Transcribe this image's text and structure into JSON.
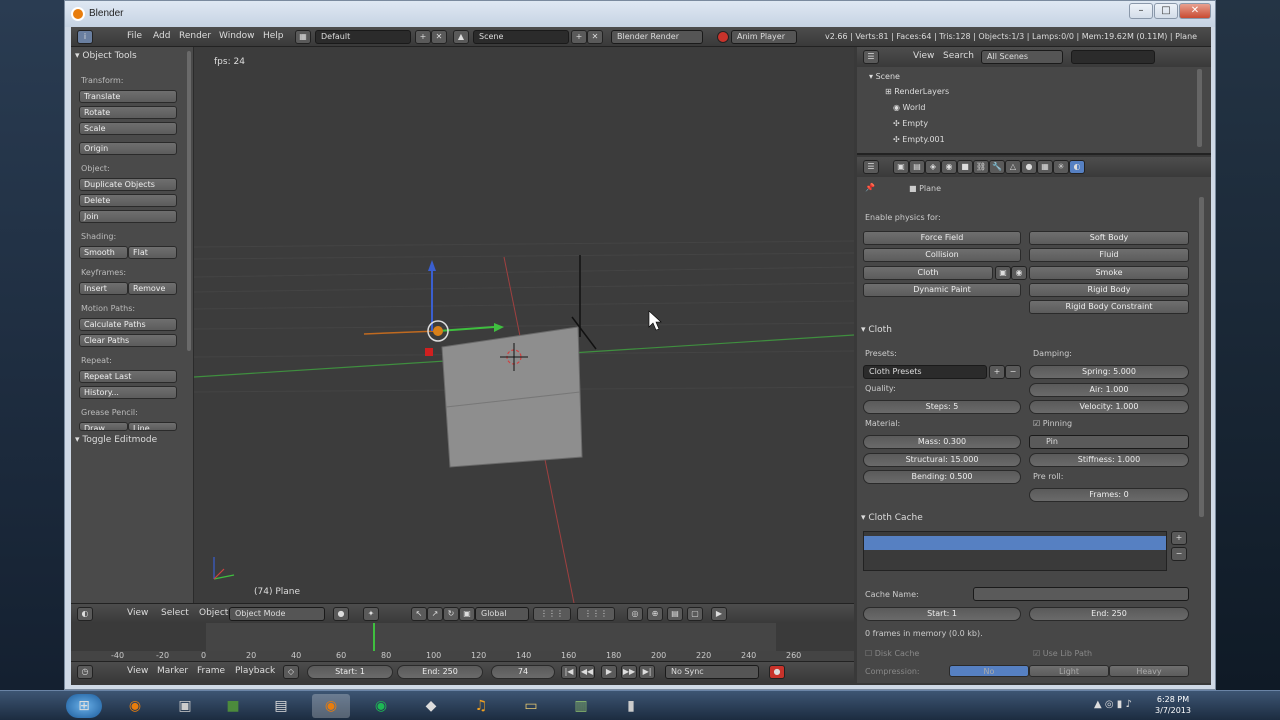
{
  "window": {
    "title": "Blender"
  },
  "topbar": {
    "menus": [
      "File",
      "Add",
      "Render",
      "Window",
      "Help"
    ],
    "layout": "Default",
    "scene": "Scene",
    "engine": "Blender Render",
    "anim_player": "Anim Player",
    "stats": "v2.66 | Verts:81 | Faces:64 | Tris:128 | Objects:1/3 | Lamps:0/0 | Mem:19.62M (0.11M) | Plane"
  },
  "tools": {
    "header": "Object Tools",
    "transform_label": "Transform:",
    "translate": "Translate",
    "rotate": "Rotate",
    "scale": "Scale",
    "origin": "Origin",
    "object_label": "Object:",
    "duplicate": "Duplicate Objects",
    "delete": "Delete",
    "join": "Join",
    "shading_label": "Shading:",
    "smooth": "Smooth",
    "flat": "Flat",
    "keyframes_label": "Keyframes:",
    "insert": "Insert",
    "remove": "Remove",
    "motion_label": "Motion Paths:",
    "calc_paths": "Calculate Paths",
    "clear_paths": "Clear Paths",
    "repeat_label": "Repeat:",
    "repeat_last": "Repeat Last",
    "history": "History...",
    "grease_label": "Grease Pencil:",
    "draw": "Draw",
    "line": "Line",
    "toggle_edit": "Toggle Editmode"
  },
  "viewport": {
    "fps": "fps: 24",
    "object_name": "(74) Plane"
  },
  "vpheader": {
    "view": "View",
    "select": "Select",
    "object": "Object",
    "mode": "Object Mode",
    "orientation": "Global"
  },
  "timeline": {
    "ticks": [
      "-40",
      "-20",
      "0",
      "20",
      "40",
      "60",
      "80",
      "100",
      "120",
      "140",
      "160",
      "180",
      "200",
      "220",
      "240",
      "260"
    ],
    "view": "View",
    "marker": "Marker",
    "frame": "Frame",
    "playback": "Playback",
    "start": "Start: 1",
    "end": "End: 250",
    "current": "74",
    "sync": "No Sync"
  },
  "outliner": {
    "view": "View",
    "search": "Search",
    "scenes": "All Scenes",
    "rows": [
      "Scene",
      "RenderLayers",
      "World",
      "Empty",
      "Empty.001"
    ]
  },
  "properties": {
    "object": "Plane",
    "enable_label": "Enable physics for:",
    "force_field": "Force Field",
    "soft_body": "Soft Body",
    "collision": "Collision",
    "fluid": "Fluid",
    "cloth": "Cloth",
    "smoke": "Smoke",
    "dynamic_paint": "Dynamic Paint",
    "rigid_body": "Rigid Body",
    "rigid_constraint": "Rigid Body Constraint",
    "cloth_panel": "Cloth",
    "presets_label": "Presets:",
    "presets_value": "Cloth Presets",
    "damping_label": "Damping:",
    "spring": "Spring: 5.000",
    "quality_label": "Quality:",
    "air": "Air: 1.000",
    "steps": "Steps: 5",
    "velocity": "Velocity: 1.000",
    "material_label": "Material:",
    "pinning": "Pinning",
    "mass": "Mass: 0.300",
    "pin": "Pin",
    "structural": "Structural: 15.000",
    "stiffness": "Stiffness: 1.000",
    "bending": "Bending: 0.500",
    "presoll_label": "Pre roll:",
    "frames": "Frames: 0",
    "cache_panel": "Cloth Cache",
    "cache_name_label": "Cache Name:",
    "cache_start": "Start: 1",
    "cache_end": "End: 250",
    "frames_in_memory": "0 frames in memory (0.0 kb).",
    "disk_cache": "Disk Cache",
    "use_lib_path": "Use Lib Path",
    "compression": "Compression:",
    "no": "No",
    "light": "Light",
    "heavy": "Heavy"
  },
  "clock": {
    "time": "6:28 PM",
    "date": "3/7/2013"
  }
}
